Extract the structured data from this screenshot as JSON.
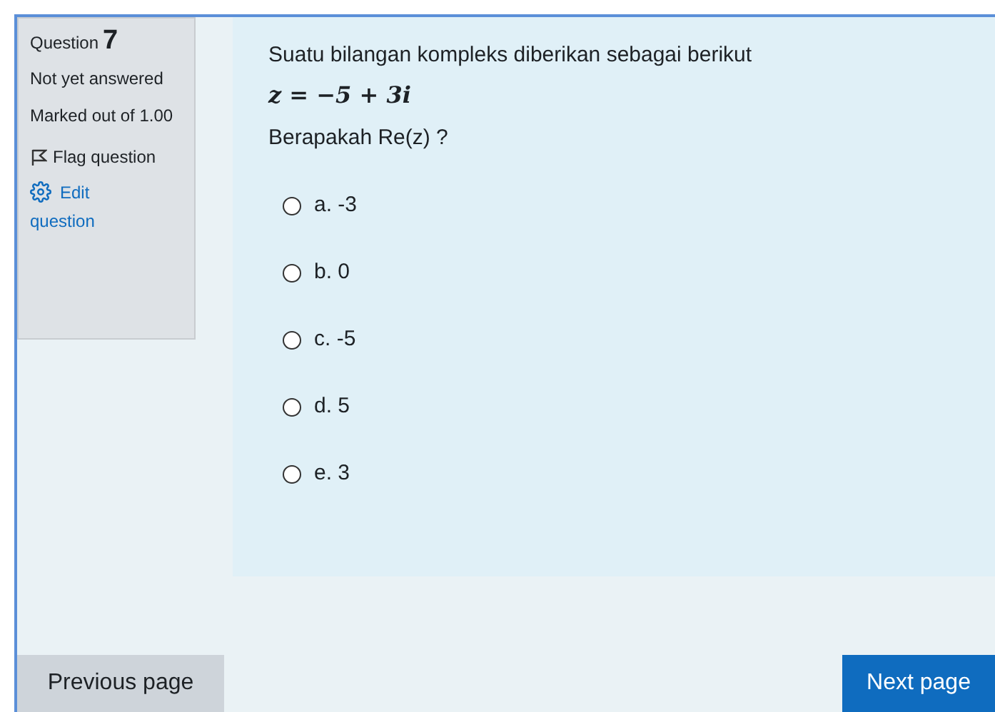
{
  "info": {
    "question_label": "Question",
    "question_number": "7",
    "status": "Not yet answered",
    "marks": "Marked out of 1.00",
    "flag": {
      "label": "Flag question",
      "flagged": false
    },
    "edit": "Edit question"
  },
  "question": {
    "prompt": "Suatu bilangan kompleks diberikan sebagai berikut",
    "formula": "z = −5 + 3i",
    "ask": "Berapakah Re(z) ?",
    "options": [
      {
        "label": "a. -3",
        "selected": false
      },
      {
        "label": "b. 0",
        "selected": false
      },
      {
        "label": "c. -5",
        "selected": false
      },
      {
        "label": "d. 5",
        "selected": false
      },
      {
        "label": "e. 3",
        "selected": false
      }
    ]
  },
  "nav": {
    "previous": "Previous page",
    "next": "Next page"
  }
}
